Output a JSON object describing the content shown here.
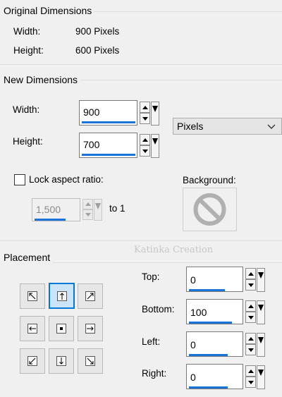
{
  "original": {
    "title": "Original Dimensions",
    "width_label": "Width:",
    "width_value": "900 Pixels",
    "height_label": "Height:",
    "height_value": "600 Pixels"
  },
  "new_dims": {
    "title": "New Dimensions",
    "width_label": "Width:",
    "width_value": "900",
    "height_label": "Height:",
    "height_value": "700",
    "units_value": "Pixels",
    "lock_label": "Lock aspect ratio:",
    "ratio_value": "1,500",
    "ratio_suffix": "to 1",
    "background_label": "Background:",
    "lock_checked": false
  },
  "watermark": "Katinka Creation",
  "placement": {
    "title": "Placement",
    "active_anchor": "top-center",
    "top_label": "Top:",
    "top_value": "0",
    "bottom_label": "Bottom:",
    "bottom_value": "100",
    "left_label": "Left:",
    "left_value": "0",
    "right_label": "Right:",
    "right_value": "0"
  },
  "colors": {
    "accent": "#1a73d9",
    "active_button": "#cce4f7",
    "active_border": "#0078d7"
  }
}
